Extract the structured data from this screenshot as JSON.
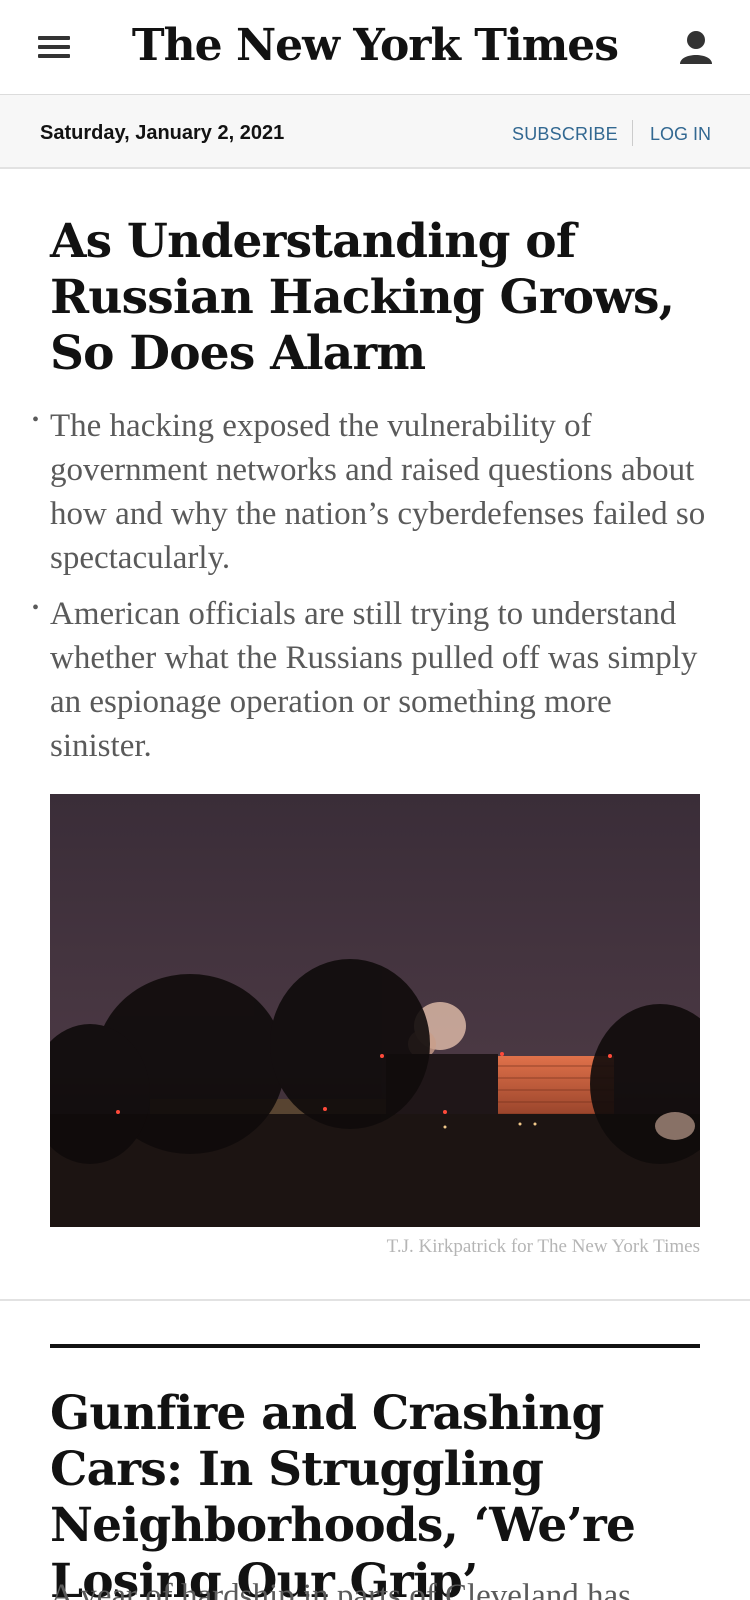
{
  "header": {
    "logo": "The New York Times",
    "menu_icon": "hamburger-menu-icon",
    "account_icon": "user-icon"
  },
  "datebar": {
    "date": "Saturday, January 2, 2021",
    "subscribe": "SUBSCRIBE",
    "login": "LOG IN"
  },
  "colors": {
    "link": "#326891",
    "summary": "#5a5a5a",
    "credit": "#b5b5b5"
  },
  "lead_story": {
    "headline": "As Understanding of Russian Hacking Grows, So Does Alarm",
    "bullets": [
      "The hacking exposed the vulnerability of government networks and raised questions about how and why the nation’s cyberdefenses failed so spectacularly.",
      "American officials are still trying to understand whether what the Russians pulled off was simply an espionage operation or something more sinister."
    ],
    "photo_credit": "T.J. Kirkpatrick for The New York Times"
  },
  "second_story": {
    "headline": "Gunfire and Crashing Cars: In Struggling Neighborhoods, ‘We’re Losing Our Grip’",
    "summary": "A year of hardship in parts of Cleveland has"
  }
}
